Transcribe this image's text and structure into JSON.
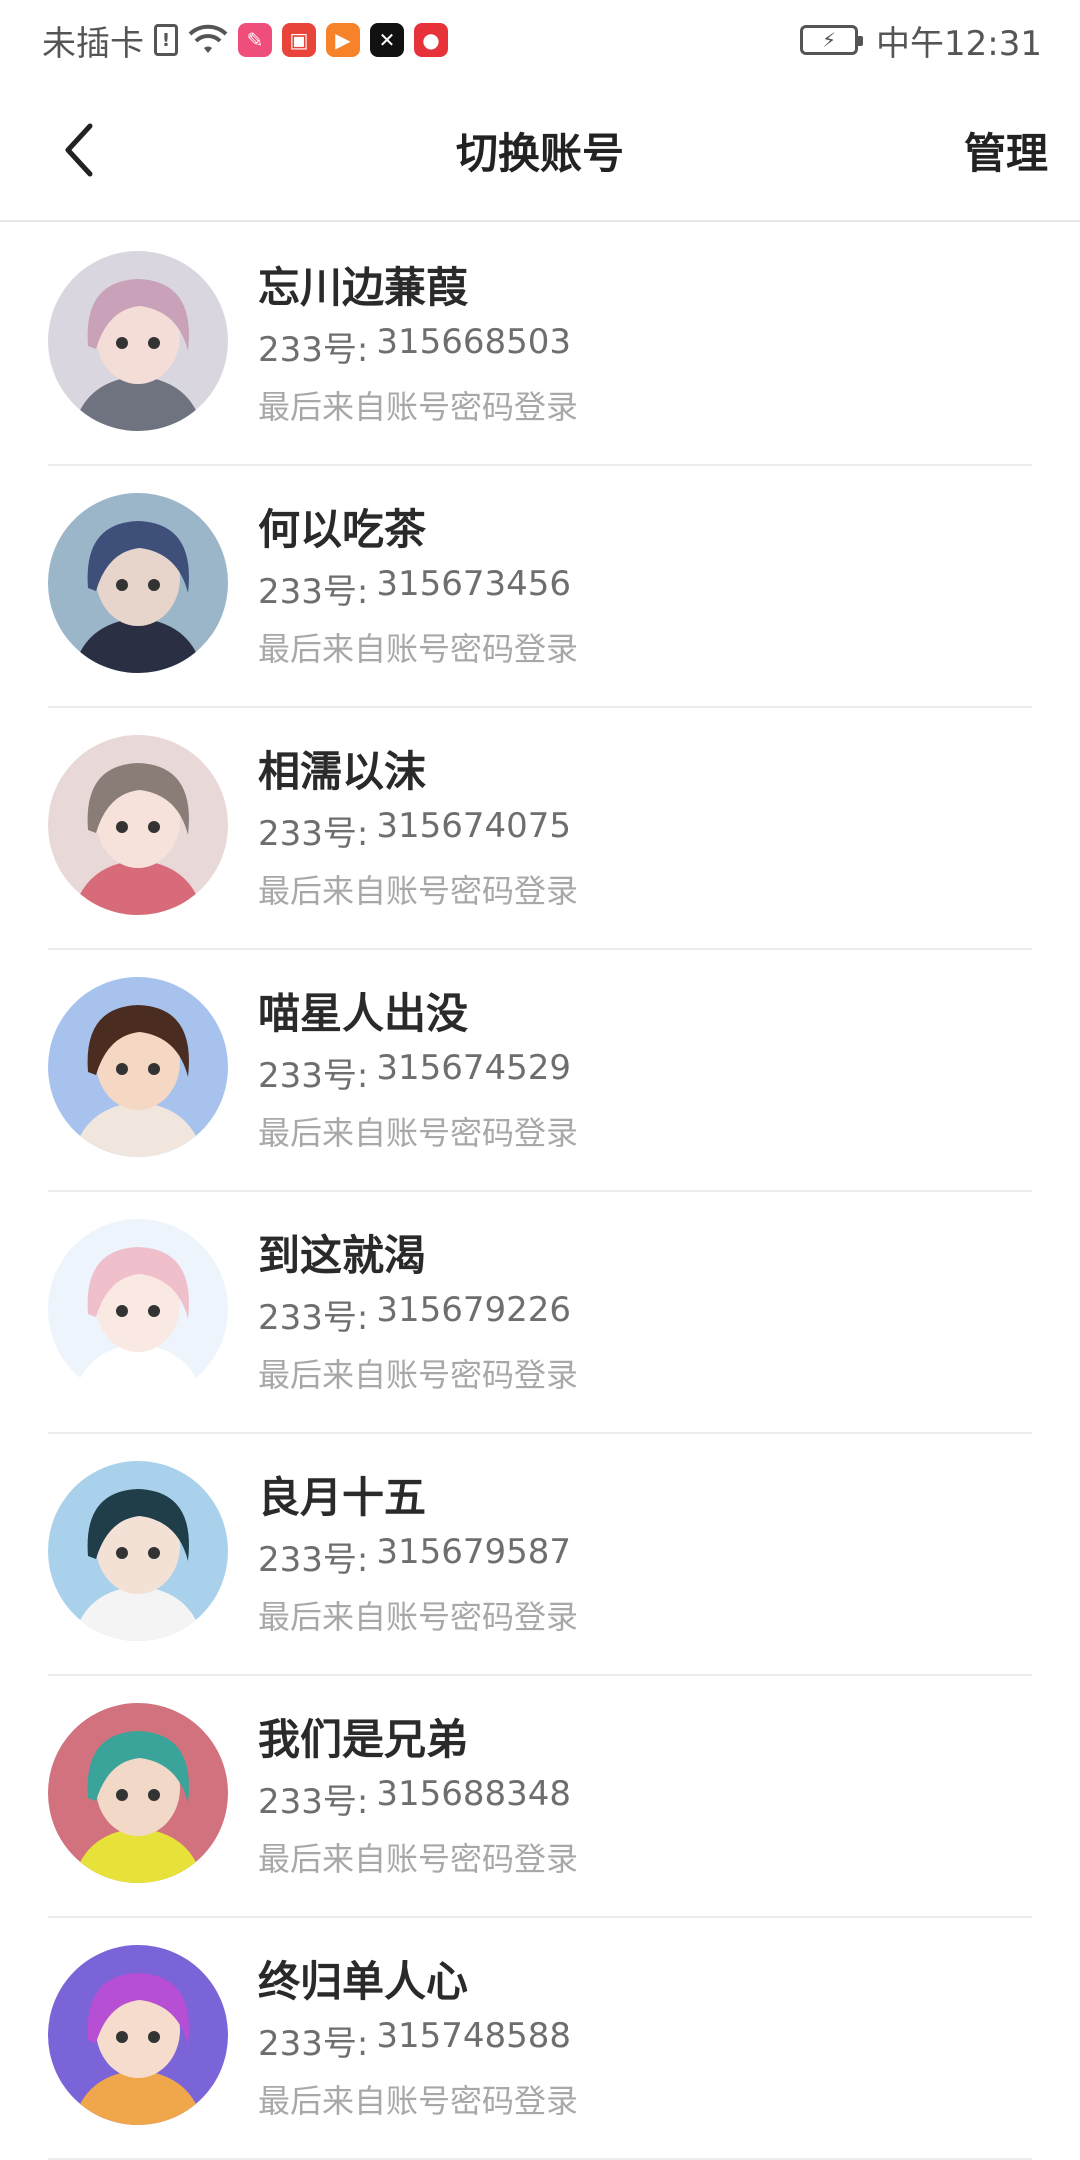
{
  "status_bar": {
    "carrier": "未插卡",
    "time": "中午12:31",
    "app_icons": [
      {
        "name": "note-app-icon",
        "color": "#f04e7a"
      },
      {
        "name": "video-app-icon",
        "color": "#e8443a"
      },
      {
        "name": "play-app-icon",
        "color": "#f6822a"
      },
      {
        "name": "capcut-app-icon",
        "color": "#111111"
      },
      {
        "name": "location-app-icon",
        "color": "#e8323a"
      }
    ]
  },
  "header": {
    "title": "切换账号",
    "manage_label": "管理"
  },
  "id_prefix": "233号:",
  "accounts": [
    {
      "name": "忘川边蒹葭",
      "id": "315668503",
      "login": "最后来自账号密码登录",
      "avatar_bg": "#d9d6df",
      "avatar_hair": "#c9a1b8",
      "avatar_skin": "#f3ddd6",
      "avatar_cloth": "#6f7380"
    },
    {
      "name": "何以吃茶",
      "id": "315673456",
      "login": "最后来自账号密码登录",
      "avatar_bg": "#9bb5c9",
      "avatar_hair": "#3e4f7a",
      "avatar_skin": "#e7d4cb",
      "avatar_cloth": "#2b2f44"
    },
    {
      "name": "相濡以沫",
      "id": "315674075",
      "login": "最后来自账号密码登录",
      "avatar_bg": "#e9d8d8",
      "avatar_hair": "#8a7d78",
      "avatar_skin": "#f6e2da",
      "avatar_cloth": "#d86b7a"
    },
    {
      "name": "喵星人出没",
      "id": "315674529",
      "login": "最后来自账号密码登录",
      "avatar_bg": "#a8c2ee",
      "avatar_hair": "#4a2c20",
      "avatar_skin": "#f4d8c4",
      "avatar_cloth": "#f1e6de"
    },
    {
      "name": "到这就渴",
      "id": "315679226",
      "login": "最后来自账号密码登录",
      "avatar_bg": "#eef4fb",
      "avatar_hair": "#efbfcc",
      "avatar_skin": "#fae8e2",
      "avatar_cloth": "#ffffff"
    },
    {
      "name": "良月十五",
      "id": "315679587",
      "login": "最后来自账号密码登录",
      "avatar_bg": "#a9d1ec",
      "avatar_hair": "#1f3e4a",
      "avatar_skin": "#f3e1d6",
      "avatar_cloth": "#f4f4f4"
    },
    {
      "name": "我们是兄弟",
      "id": "315688348",
      "login": "最后来自账号密码登录",
      "avatar_bg": "#d1727e",
      "avatar_hair": "#3aa39a",
      "avatar_skin": "#f2d8c6",
      "avatar_cloth": "#e6e23a"
    },
    {
      "name": "终归单人心",
      "id": "315748588",
      "login": "最后来自账号密码登录",
      "avatar_bg": "#7b64d8",
      "avatar_hair": "#b64fd4",
      "avatar_skin": "#f6dccd",
      "avatar_cloth": "#f0a64a"
    }
  ]
}
